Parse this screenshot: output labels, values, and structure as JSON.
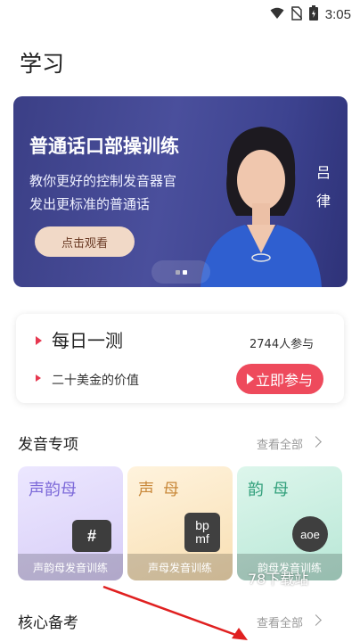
{
  "status_bar": {
    "time": "3:05",
    "icons": [
      "wifi-icon",
      "no-sim-icon",
      "battery-icon"
    ]
  },
  "page": {
    "title": "学习"
  },
  "banner": {
    "title": "普通话口部操训练",
    "subtitle_line1": "教你更好的控制发音器官",
    "subtitle_line2": "发出更标准的普通话",
    "button_label": "点击观看",
    "presenter_name": "吕律",
    "pager_pages": 2,
    "pager_active": 2
  },
  "daily_test": {
    "title": "每日一测",
    "participants": "2744人参与",
    "value_text": "二十美金的价值",
    "join_label": "立即参与",
    "accent_color": "#ee4a5c"
  },
  "pronunciation": {
    "section_title": "发音专项",
    "view_all": "查看全部",
    "cards": [
      {
        "category": "声韵母",
        "badge": "#",
        "label": "声韵母发音训练"
      },
      {
        "category": "声母",
        "badge_line1": "bp",
        "badge_line2": "mf",
        "label": "声母发音训练"
      },
      {
        "category": "韵母",
        "badge": "aoe",
        "label": "韵母发音训练"
      }
    ]
  },
  "exam": {
    "section_title": "核心备考",
    "view_all": "查看全部"
  },
  "watermark": "78下载站"
}
